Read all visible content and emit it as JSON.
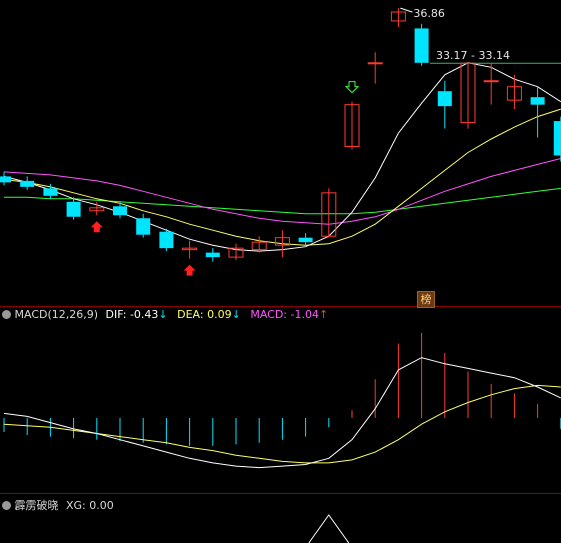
{
  "colors": {
    "background": "#000000",
    "up": "#ff3b30",
    "down": "#00e5ff",
    "ma_white": "#ffffff",
    "ma_yellow": "#ffff66",
    "ma_magenta": "#ff55ff",
    "ma_green": "#33ff33",
    "panel_border": "#8b0000",
    "dif": "#ffffff",
    "dea": "#ffff66",
    "macd": "#ff55ff",
    "buy_arrow": "#ff2020",
    "ref_line": "#3cb371"
  },
  "price_panel": {
    "high_label": "36.86",
    "range_label": "33.17 - 33.14",
    "badge": "榜"
  },
  "macd_panel": {
    "title": "MACD(12,26,9)",
    "dif_label": "DIF:",
    "dif_value": "-0.43",
    "dif_arrow": "↓",
    "dea_label": "DEA:",
    "dea_value": "0.09",
    "dea_arrow": "↓",
    "macd_label": "MACD:",
    "macd_value": "-1.04",
    "macd_arrow": "↑"
  },
  "xg_panel": {
    "title": "霹雳破晓",
    "xg_label": "XG:",
    "xg_value": "0.00"
  },
  "chart_data": {
    "type": "candlestick",
    "candles": [
      {
        "o": 25.6,
        "c": 25.2,
        "h": 25.9,
        "l": 25.0
      },
      {
        "o": 25.3,
        "c": 24.9,
        "h": 25.6,
        "l": 24.7
      },
      {
        "o": 24.8,
        "c": 24.3,
        "h": 25.1,
        "l": 24.1
      },
      {
        "o": 23.9,
        "c": 22.9,
        "h": 24.2,
        "l": 22.7
      },
      {
        "o": 23.3,
        "c": 23.5,
        "h": 23.9,
        "l": 23.0
      },
      {
        "o": 23.6,
        "c": 23.0,
        "h": 23.9,
        "l": 22.8
      },
      {
        "o": 22.8,
        "c": 21.7,
        "h": 23.1,
        "l": 21.5
      },
      {
        "o": 21.9,
        "c": 20.8,
        "h": 22.1,
        "l": 20.6
      },
      {
        "o": 20.7,
        "c": 20.8,
        "h": 21.3,
        "l": 20.1
      },
      {
        "o": 20.5,
        "c": 20.2,
        "h": 20.8,
        "l": 19.9
      },
      {
        "o": 20.2,
        "c": 20.8,
        "h": 21.1,
        "l": 20.0
      },
      {
        "o": 20.7,
        "c": 21.2,
        "h": 21.6,
        "l": 20.5
      },
      {
        "o": 21.0,
        "c": 21.5,
        "h": 22.0,
        "l": 20.2
      },
      {
        "o": 21.5,
        "c": 21.2,
        "h": 21.8,
        "l": 21.0
      },
      {
        "o": 21.6,
        "c": 24.5,
        "h": 24.8,
        "l": 21.5
      },
      {
        "o": 27.6,
        "c": 30.4,
        "h": 30.6,
        "l": 27.4
      },
      {
        "o": 33.2,
        "c": 33.2,
        "h": 33.9,
        "l": 31.8
      },
      {
        "o": 36.0,
        "c": 36.6,
        "h": 36.86,
        "l": 35.6
      },
      {
        "o": 35.5,
        "c": 33.2,
        "h": 35.8,
        "l": 33.0
      },
      {
        "o": 31.3,
        "c": 30.3,
        "h": 32.0,
        "l": 28.8
      },
      {
        "o": 29.2,
        "c": 33.17,
        "h": 33.17,
        "l": 28.8
      },
      {
        "o": 32.0,
        "c": 32.0,
        "h": 33.14,
        "l": 30.4
      },
      {
        "o": 30.7,
        "c": 31.6,
        "h": 32.4,
        "l": 30.1
      },
      {
        "o": 30.9,
        "c": 30.4,
        "h": 31.6,
        "l": 28.2
      },
      {
        "o": 29.3,
        "c": 27.0,
        "h": 29.6,
        "l": 26.6
      }
    ],
    "ma_white": [
      25.6,
      25.2,
      24.7,
      24.1,
      23.7,
      23.2,
      22.6,
      22.0,
      21.4,
      21.0,
      20.7,
      20.6,
      20.7,
      20.9,
      21.6,
      23.2,
      25.5,
      28.5,
      30.5,
      32.4,
      33.2,
      32.9,
      32.1,
      31.6,
      30.6
    ],
    "ma_yellow": [
      25.4,
      25.2,
      24.9,
      24.5,
      24.1,
      23.8,
      23.3,
      22.9,
      22.4,
      22.0,
      21.6,
      21.3,
      21.1,
      21.0,
      21.1,
      21.6,
      22.4,
      23.6,
      24.8,
      26.0,
      27.2,
      28.1,
      28.9,
      29.6,
      30.1
    ],
    "ma_magenta": [
      25.9,
      25.8,
      25.7,
      25.5,
      25.3,
      25.0,
      24.6,
      24.2,
      23.8,
      23.4,
      23.1,
      22.8,
      22.6,
      22.5,
      22.4,
      22.6,
      22.9,
      23.4,
      24.0,
      24.6,
      25.1,
      25.6,
      26.0,
      26.4,
      26.8
    ],
    "ma_green": [
      24.2,
      24.2,
      24.1,
      24.1,
      24.0,
      23.9,
      23.8,
      23.7,
      23.6,
      23.5,
      23.4,
      23.3,
      23.2,
      23.1,
      23.1,
      23.1,
      23.2,
      23.4,
      23.6,
      23.8,
      24.0,
      24.2,
      24.4,
      24.6,
      24.8
    ],
    "buy_arrows": [
      4,
      8
    ],
    "sell_arrows": [
      15
    ],
    "macd_hist": [
      -0.9,
      -1.1,
      -1.2,
      -1.3,
      -1.4,
      -1.5,
      -1.6,
      -1.7,
      -1.8,
      -1.8,
      -1.7,
      -1.6,
      -1.4,
      -1.2,
      -0.6,
      0.5,
      2.5,
      4.8,
      5.5,
      4.2,
      3.0,
      2.2,
      1.6,
      0.9,
      -0.7
    ],
    "dif": [
      0.3,
      0.1,
      -0.3,
      -0.7,
      -1.0,
      -1.4,
      -1.8,
      -2.2,
      -2.6,
      -2.9,
      -3.1,
      -3.2,
      -3.1,
      -3.0,
      -2.6,
      -1.4,
      0.6,
      3.1,
      3.9,
      3.5,
      3.2,
      2.9,
      2.6,
      2.0,
      1.3
    ],
    "dea": [
      -0.4,
      -0.5,
      -0.6,
      -0.8,
      -1.0,
      -1.2,
      -1.4,
      -1.6,
      -1.9,
      -2.1,
      -2.4,
      -2.6,
      -2.8,
      -2.9,
      -2.9,
      -2.7,
      -2.2,
      -1.4,
      -0.4,
      0.4,
      1.0,
      1.5,
      1.9,
      2.1,
      2.0
    ],
    "xg_signals": [
      14
    ],
    "price_range": [
      18,
      37
    ],
    "macd_range": [
      -4,
      6
    ]
  }
}
